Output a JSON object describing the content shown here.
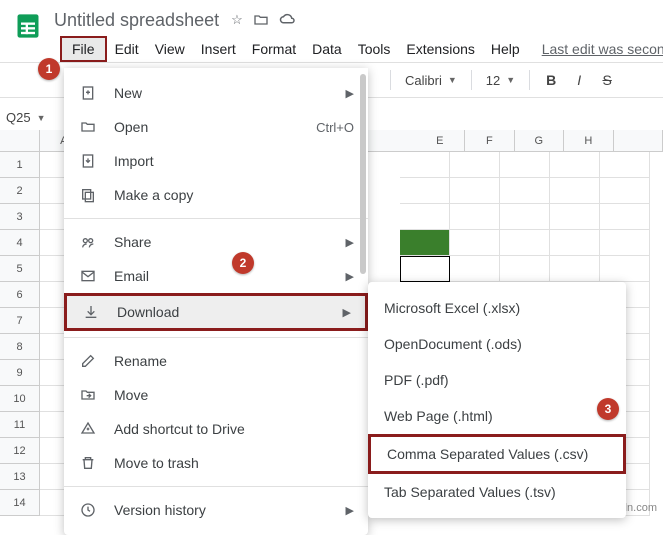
{
  "doc": {
    "title": "Untitled spreadsheet"
  },
  "menubar": {
    "file": "File",
    "edit": "Edit",
    "view": "View",
    "insert": "Insert",
    "format": "Format",
    "data": "Data",
    "tools": "Tools",
    "extensions": "Extensions",
    "help": "Help",
    "last_edit": "Last edit was second"
  },
  "toolbar": {
    "font": "Calibri",
    "font_size": "12"
  },
  "cell_ref": "Q25",
  "columns": [
    "A",
    "E",
    "F",
    "G",
    "H"
  ],
  "rows": [
    "1",
    "2",
    "3",
    "4",
    "5",
    "6",
    "7",
    "8",
    "9",
    "10",
    "11",
    "12",
    "13",
    "14"
  ],
  "file_menu": {
    "new": "New",
    "open": "Open",
    "open_shortcut": "Ctrl+O",
    "import": "Import",
    "make_copy": "Make a copy",
    "share": "Share",
    "email": "Email",
    "download": "Download",
    "rename": "Rename",
    "move": "Move",
    "add_shortcut": "Add shortcut to Drive",
    "move_to_trash": "Move to trash",
    "version_history": "Version history"
  },
  "download_submenu": {
    "xlsx": "Microsoft Excel (.xlsx)",
    "ods": "OpenDocument (.ods)",
    "pdf": "PDF (.pdf)",
    "html": "Web Page (.html)",
    "csv": "Comma Separated Values (.csv)",
    "tsv": "Tab Separated Values (.tsv)"
  },
  "callouts": {
    "c1": "1",
    "c2": "2",
    "c3": "3"
  },
  "watermark": "wsxdn.com"
}
